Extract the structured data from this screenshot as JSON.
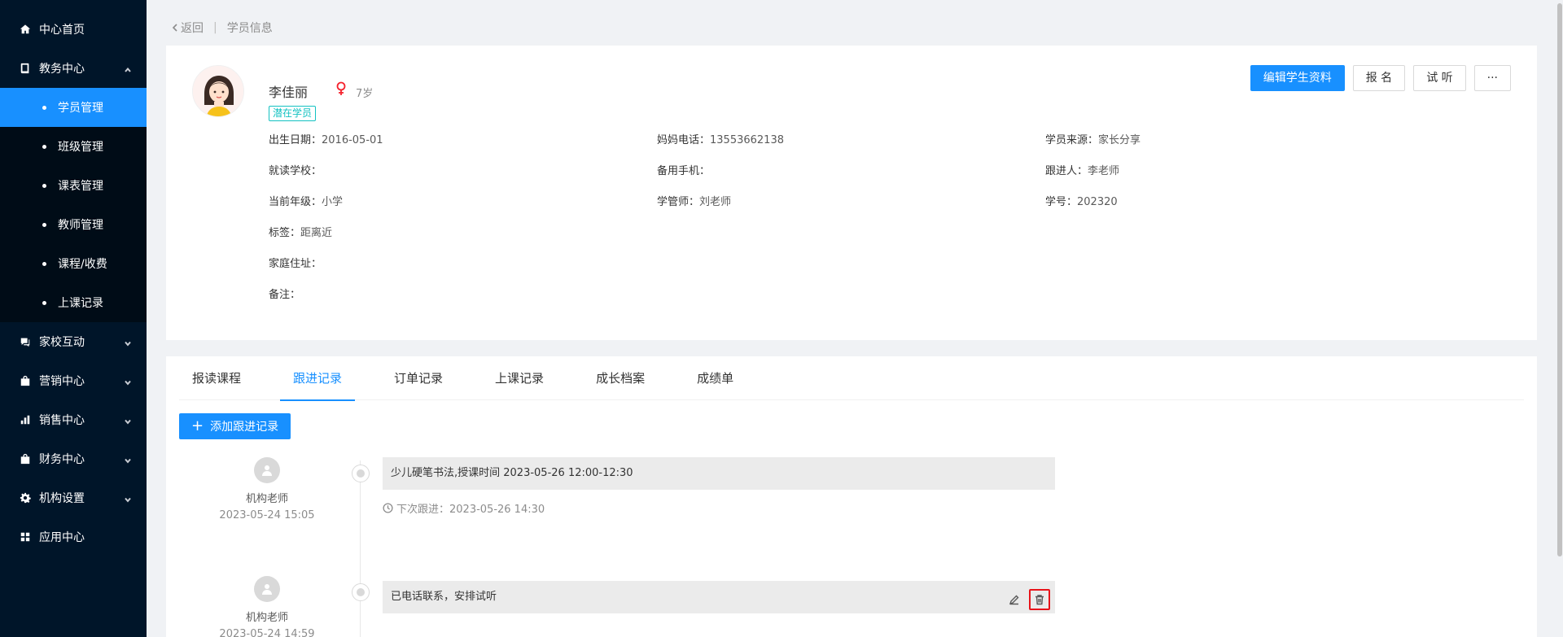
{
  "sidebar": {
    "items": [
      {
        "label": "中心首页",
        "icon": "home-icon"
      },
      {
        "label": "教务中心",
        "icon": "book-icon",
        "expanded": true,
        "children": [
          "学员管理",
          "班级管理",
          "课表管理",
          "教师管理",
          "课程/收费",
          "上课记录"
        ],
        "active_child": "学员管理"
      },
      {
        "label": "家校互动",
        "icon": "chat-icon"
      },
      {
        "label": "营销中心",
        "icon": "bag-icon"
      },
      {
        "label": "销售中心",
        "icon": "chart-icon"
      },
      {
        "label": "财务中心",
        "icon": "wallet-icon"
      },
      {
        "label": "机构设置",
        "icon": "gear-icon"
      },
      {
        "label": "应用中心",
        "icon": "grid-icon"
      }
    ]
  },
  "breadcrumb": {
    "back": "返回",
    "sep": "|",
    "current": "学员信息"
  },
  "student": {
    "name": "李佳丽",
    "age": "7岁",
    "status": "潜在学员",
    "fields": {
      "birth": {
        "label": "出生日期：",
        "value": "2016-05-01"
      },
      "mom_phone": {
        "label": "妈妈电话：",
        "value": "13553662138"
      },
      "source": {
        "label": "学员来源：",
        "value": "家长分享"
      },
      "school": {
        "label": "就读学校：",
        "value": ""
      },
      "backup_phone": {
        "label": "备用手机：",
        "value": ""
      },
      "follower": {
        "label": "跟进人：",
        "value": "李老师"
      },
      "grade": {
        "label": "当前年级：",
        "value": "小学"
      },
      "manager": {
        "label": "学管师：",
        "value": "刘老师"
      },
      "student_no": {
        "label": "学号：",
        "value": "202320"
      },
      "tags": {
        "label": "标签：",
        "value": "距离近"
      },
      "address": {
        "label": "家庭住址：",
        "value": ""
      },
      "remark": {
        "label": "备注：",
        "value": ""
      }
    }
  },
  "actions": {
    "edit": "编辑学生资料",
    "enroll": "报 名",
    "trial": "试 听",
    "more": "···"
  },
  "tabs": {
    "items": [
      "报读课程",
      "跟进记录",
      "订单记录",
      "上课记录",
      "成长档案",
      "成绩单"
    ],
    "active": "跟进记录"
  },
  "add_record": {
    "label": "添加跟进记录"
  },
  "timeline": [
    {
      "author": "机构老师",
      "time": "2023-05-24 15:05",
      "content": "少儿硬笔书法,授课时间 2023-05-26 12:00-12:30",
      "next": "下次跟进：2023-05-26 14:30"
    },
    {
      "author": "机构老师",
      "time": "2023-05-24 14:59",
      "content": "已电话联系，安排试听"
    }
  ],
  "colors": {
    "primary": "#1890ff",
    "sidebar_bg": "#001529",
    "submenu_bg": "#000c17",
    "status_tag": "#13c2c2",
    "gender": "#f5222d",
    "highlight": "#e8141a"
  }
}
